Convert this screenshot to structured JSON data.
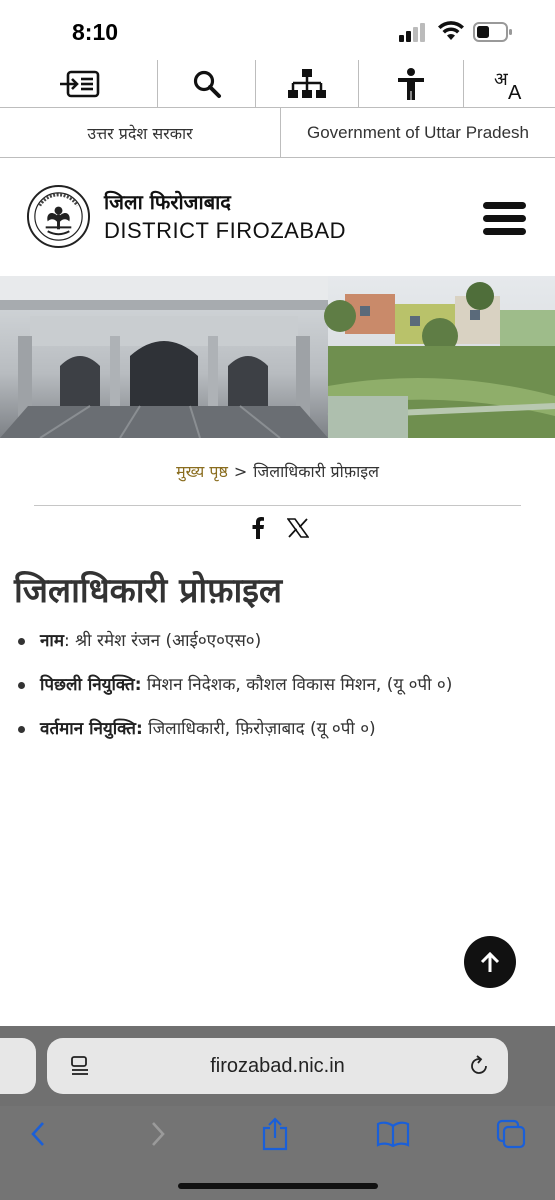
{
  "status_bar": {
    "time": "8:10"
  },
  "a11y_toolbar": {
    "icons": [
      "skip-to-content-icon",
      "search-icon",
      "sitemap-icon",
      "accessibility-icon",
      "language-icon"
    ]
  },
  "gov_bar": {
    "hindi": "उत्तर प्रदेश सरकार",
    "english": "Government of Uttar Pradesh"
  },
  "header": {
    "district_hindi": "जिला फिरोजाबाद",
    "district_english": "DISTRICT FIROZABAD"
  },
  "breadcrumb": {
    "home": "मुख्य पृष्ठ",
    "separator": ">",
    "current": "जिलाधिकारी प्रोफ़ाइल"
  },
  "share": {
    "icons": [
      "facebook-icon",
      "x-icon"
    ]
  },
  "page": {
    "title": "जिलाधिकारी प्रोफ़ाइल",
    "details": [
      {
        "label": "नाम",
        "value": ": श्री रमेश रंजन (आई०ए०एस०)"
      },
      {
        "label": "पिछली नियुक्ति:",
        "value": " मिशन निदेशक, कौशल विकास मिशन, (यू ०पी ०)"
      },
      {
        "label": "वर्तमान नियुक्ति:",
        "value": " जिलाधिकारी, फ़िरोज़ाबाद (यू ०पी ०)"
      }
    ]
  },
  "browser": {
    "url": "firozabad.nic.in"
  },
  "colors": {
    "breadcrumb_home": "#8a6d1f",
    "safari_bar": "#707070",
    "accent_blue": "#1a5fd8"
  }
}
